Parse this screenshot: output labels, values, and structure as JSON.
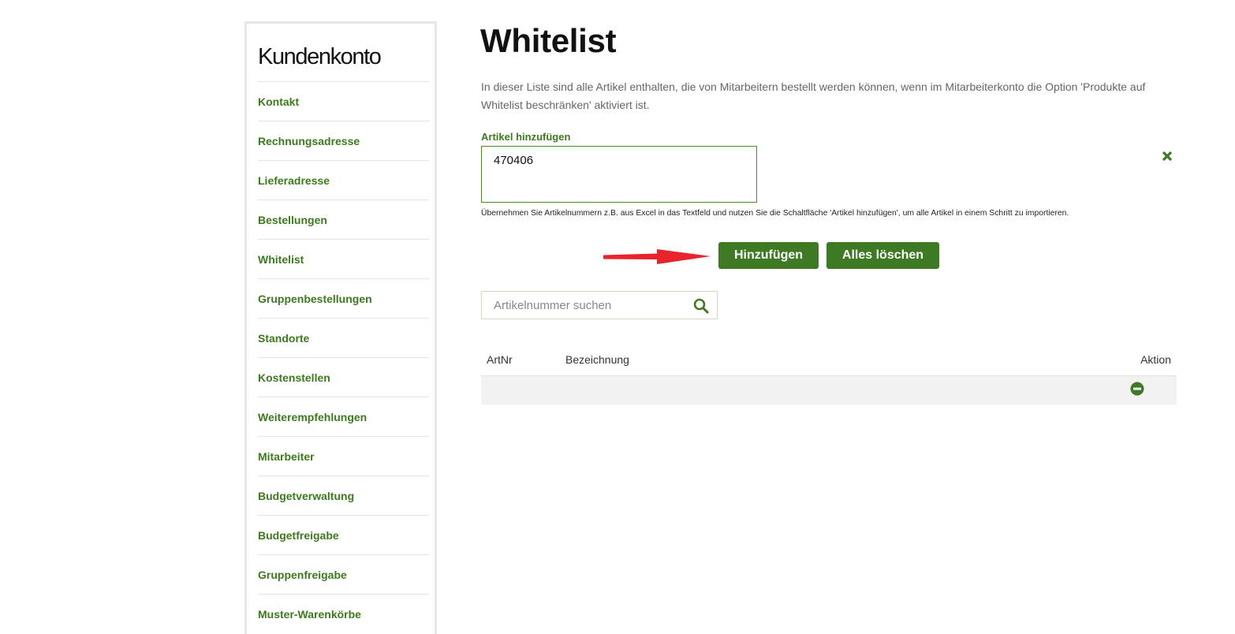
{
  "sidebar": {
    "title": "Kundenkonto",
    "items": [
      {
        "label": "Kontakt"
      },
      {
        "label": "Rechnungsadresse"
      },
      {
        "label": "Lieferadresse"
      },
      {
        "label": "Bestellungen"
      },
      {
        "label": "Whitelist"
      },
      {
        "label": "Gruppenbestellungen"
      },
      {
        "label": "Standorte"
      },
      {
        "label": "Kostenstellen"
      },
      {
        "label": "Weiterempfehlungen"
      },
      {
        "label": "Mitarbeiter"
      },
      {
        "label": "Budgetverwaltung"
      },
      {
        "label": "Budgetfreigabe"
      },
      {
        "label": "Gruppenfreigabe"
      },
      {
        "label": "Muster-Warenkörbe"
      }
    ]
  },
  "main": {
    "title": "Whitelist",
    "intro": "In dieser Liste sind alle Artikel enthalten, die von Mitarbeitern bestellt werden können, wenn im Mitarbeiterkonto die Option 'Produkte auf Whitelist beschränken' aktiviert ist.",
    "add_label": "Artikel hinzufügen",
    "article_input_value": "470406",
    "hint": "Übernehmen Sie Artikelnummern z.B. aus Excel in das Textfeld und nutzen Sie die Schaltfläche 'Artikel hinzufügen', um alle Artikel in einem Schritt zu importieren.",
    "add_button": "Hinzufügen",
    "clear_button": "Alles löschen",
    "search_placeholder": "Artikelnummer suchen"
  },
  "table": {
    "headers": {
      "artnr": "ArtNr",
      "bezeichnung": "Bezeichnung",
      "aktion": "Aktion"
    },
    "rows": [
      {
        "artnr": "",
        "bezeichnung": ""
      }
    ]
  },
  "icons": {
    "close": "close-icon",
    "search": "search-icon",
    "remove": "minus-circle-icon",
    "arrow": "arrow-right-annotation"
  },
  "colors": {
    "accent": "#3e7a24",
    "link": "#3c7a1e",
    "annotation_arrow": "#e8232a"
  }
}
